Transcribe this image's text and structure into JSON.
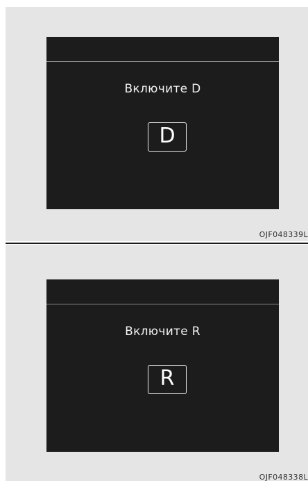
{
  "figures": [
    {
      "prompt": "Включите D",
      "gear": "D",
      "code": "OJF048339L"
    },
    {
      "prompt": "Включите R",
      "gear": "R",
      "code": "OJF048338L"
    }
  ]
}
